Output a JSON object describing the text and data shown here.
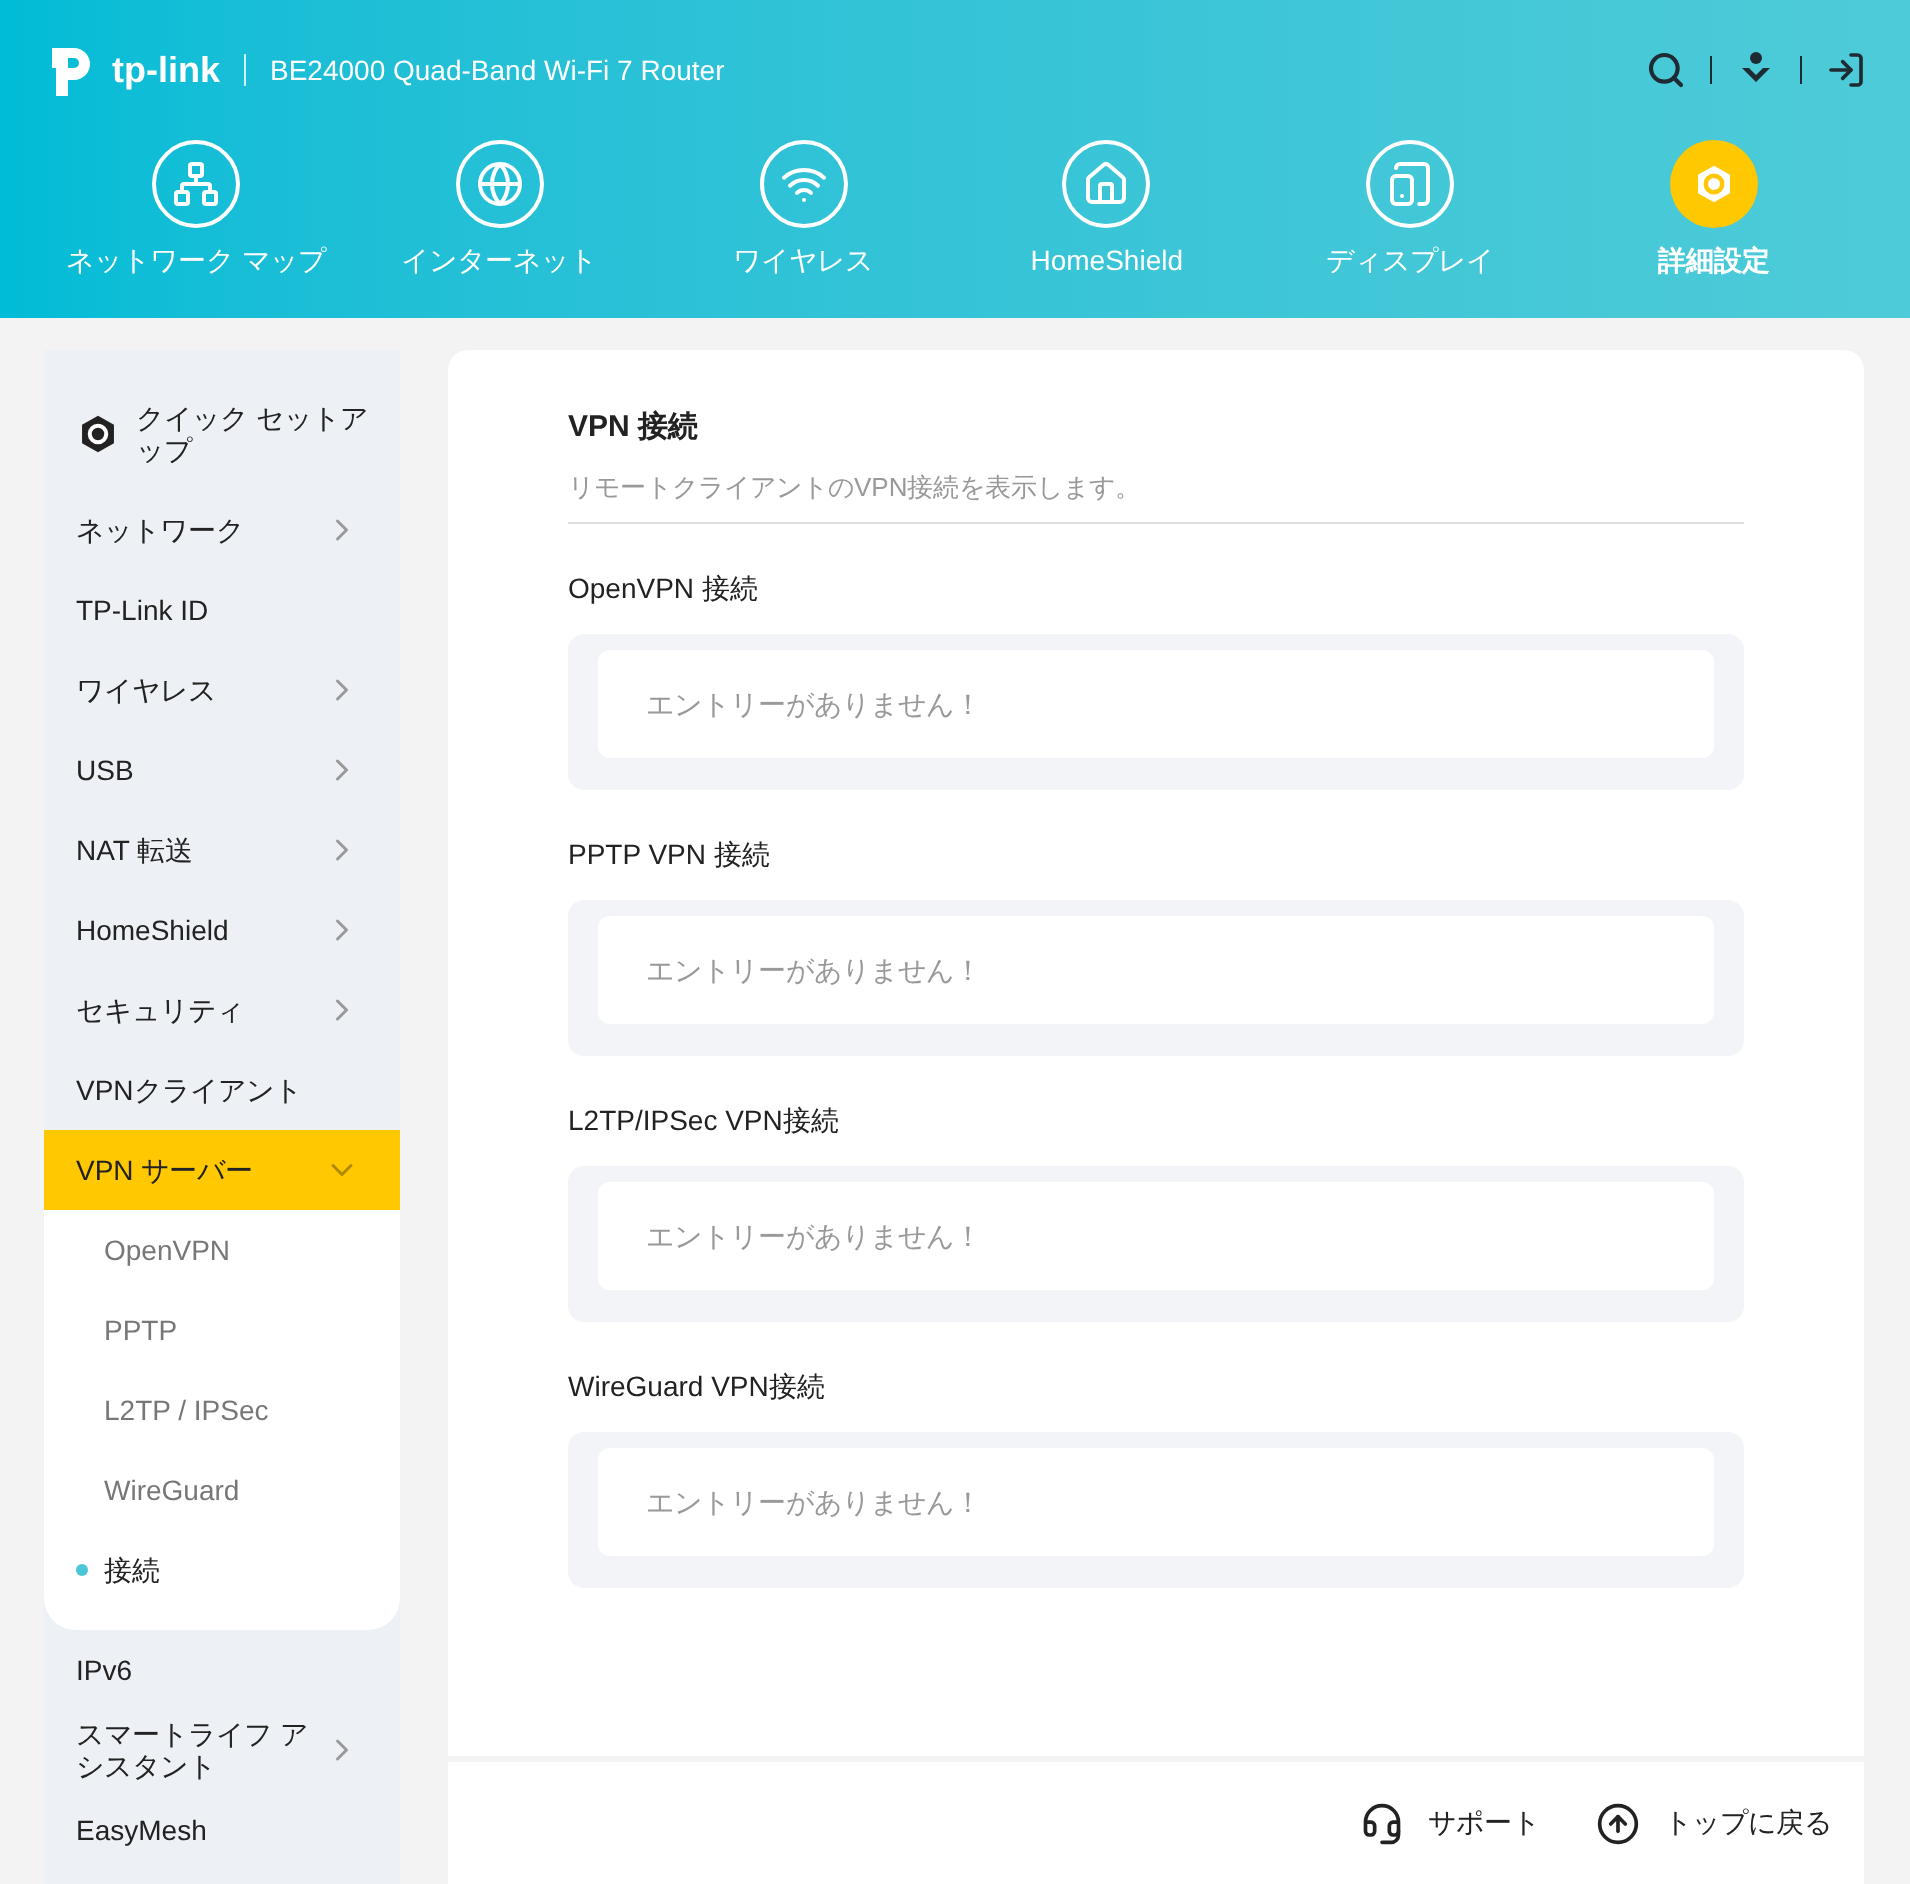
{
  "header": {
    "logo": "tp-link",
    "model": "BE24000 Quad-Band Wi-Fi 7 Router"
  },
  "nav": [
    {
      "label": "ネットワーク マップ",
      "kind": "network",
      "selected": false
    },
    {
      "label": "インターネット",
      "kind": "globe",
      "selected": false
    },
    {
      "label": "ワイヤレス",
      "kind": "wifi",
      "selected": false
    },
    {
      "label": "HomeShield",
      "kind": "shield",
      "selected": false
    },
    {
      "label": "ディスプレイ",
      "kind": "display",
      "selected": false
    },
    {
      "label": "詳細設定",
      "kind": "gear",
      "selected": true
    }
  ],
  "sidebar": {
    "items": [
      {
        "label": "クイック セットアップ",
        "kind": "setup"
      },
      {
        "label": "ネットワーク",
        "kind": "group",
        "expanded": false
      },
      {
        "label": "TP-Link ID",
        "kind": "link"
      },
      {
        "label": "ワイヤレス",
        "kind": "group",
        "expanded": false
      },
      {
        "label": "USB",
        "kind": "group",
        "expanded": false
      },
      {
        "label": "NAT 転送",
        "kind": "group",
        "expanded": false
      },
      {
        "label": "HomeShield",
        "kind": "group",
        "expanded": false
      },
      {
        "label": "セキュリティ",
        "kind": "group",
        "expanded": false
      },
      {
        "label": "VPNクライアント",
        "kind": "link"
      },
      {
        "label": "VPN サーバー",
        "kind": "group",
        "expanded": true,
        "children": [
          {
            "label": "OpenVPN",
            "selected": false
          },
          {
            "label": "PPTP",
            "selected": false
          },
          {
            "label": "L2TP / IPSec",
            "selected": false
          },
          {
            "label": "WireGuard",
            "selected": false
          },
          {
            "label": "接続",
            "selected": true
          }
        ]
      },
      {
        "label": "IPv6",
        "kind": "link"
      },
      {
        "label": "スマートライフ アシスタント",
        "kind": "group",
        "expanded": false
      },
      {
        "label": "EasyMesh",
        "kind": "link"
      }
    ]
  },
  "content": {
    "title": "VPN 接続",
    "description": "リモートクライアントのVPN接続を表示します。",
    "sections": [
      {
        "title": "OpenVPN 接続",
        "empty_text": "エントリーがありません！"
      },
      {
        "title": "PPTP VPN 接続",
        "empty_text": "エントリーがありません！"
      },
      {
        "title": "L2TP/IPSec VPN接続",
        "empty_text": "エントリーがありません！"
      },
      {
        "title": "WireGuard VPN接続",
        "empty_text": "エントリーがありません！"
      }
    ]
  },
  "footer": [
    {
      "label": "サポート",
      "kind": "support"
    },
    {
      "label": "トップに戻る",
      "kind": "top"
    }
  ]
}
